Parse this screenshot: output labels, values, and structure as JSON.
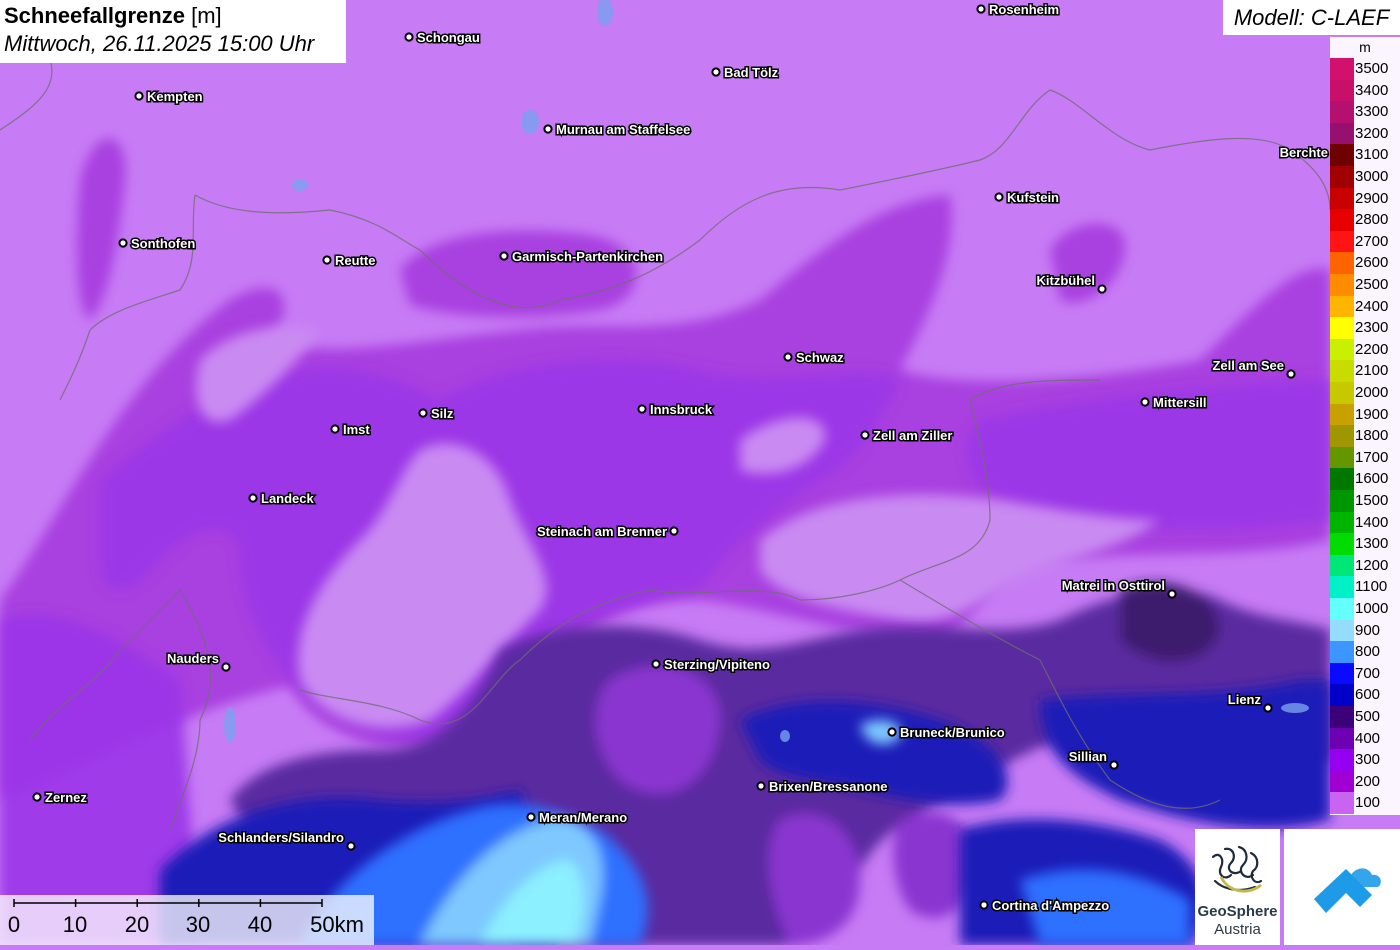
{
  "header": {
    "title": "Schneefallgrenze",
    "unit": "[m]",
    "datetime": "Mittwoch, 26.11.2025 15:00 Uhr",
    "model": "Modell: C-LAEF"
  },
  "legend": {
    "unit": "m",
    "entries": [
      {
        "label": "3500",
        "color": "#d2106e"
      },
      {
        "label": "3400",
        "color": "#c8106a"
      },
      {
        "label": "3300",
        "color": "#b41070"
      },
      {
        "label": "3200",
        "color": "#961070"
      },
      {
        "label": "3100",
        "color": "#6e0000"
      },
      {
        "label": "3000",
        "color": "#a00000"
      },
      {
        "label": "2900",
        "color": "#c80000"
      },
      {
        "label": "2800",
        "color": "#e60000"
      },
      {
        "label": "2700",
        "color": "#ff1414"
      },
      {
        "label": "2600",
        "color": "#ff6400"
      },
      {
        "label": "2500",
        "color": "#ff8c00"
      },
      {
        "label": "2400",
        "color": "#ffb400"
      },
      {
        "label": "2300",
        "color": "#ffff00"
      },
      {
        "label": "2200",
        "color": "#c8f000"
      },
      {
        "label": "2100",
        "color": "#c8dc00"
      },
      {
        "label": "2000",
        "color": "#c8c800"
      },
      {
        "label": "1900",
        "color": "#c8a000"
      },
      {
        "label": "1800",
        "color": "#a09600"
      },
      {
        "label": "1700",
        "color": "#649600"
      },
      {
        "label": "1600",
        "color": "#007800"
      },
      {
        "label": "1500",
        "color": "#009600"
      },
      {
        "label": "1400",
        "color": "#00b400"
      },
      {
        "label": "1300",
        "color": "#00dc00"
      },
      {
        "label": "1200",
        "color": "#00e678"
      },
      {
        "label": "1100",
        "color": "#00f0c8"
      },
      {
        "label": "1000",
        "color": "#64ffff"
      },
      {
        "label": "900",
        "color": "#96dcff"
      },
      {
        "label": "800",
        "color": "#3c96ff"
      },
      {
        "label": "700",
        "color": "#0a0aff"
      },
      {
        "label": "600",
        "color": "#0000c8"
      },
      {
        "label": "500",
        "color": "#3c0078"
      },
      {
        "label": "400",
        "color": "#6e00b4"
      },
      {
        "label": "300",
        "color": "#9600f0"
      },
      {
        "label": "200",
        "color": "#a000d2"
      },
      {
        "label": "100",
        "color": "#c864f0"
      }
    ]
  },
  "scale": {
    "labels": [
      "0",
      "10",
      "20",
      "30",
      "40",
      "50km"
    ]
  },
  "logos": {
    "geosphere_line1": "GeoSphere",
    "geosphere_line2": "Austria"
  },
  "cities": [
    {
      "name": "Rosenheim",
      "dot": [
        981,
        9
      ],
      "side": "right"
    },
    {
      "name": "Schongau",
      "dot": [
        409,
        37
      ],
      "side": "right"
    },
    {
      "name": "Bad Tölz",
      "dot": [
        716,
        72
      ],
      "side": "right"
    },
    {
      "name": "Kempten",
      "dot": [
        139,
        96
      ],
      "side": "right"
    },
    {
      "name": "Murnau am Staffelsee",
      "dot": [
        548,
        129
      ],
      "side": "right"
    },
    {
      "name": "Berchte",
      "dot": [
        1335,
        152
      ],
      "side": "left"
    },
    {
      "name": "Kufstein",
      "dot": [
        999,
        197
      ],
      "side": "right"
    },
    {
      "name": "Sonthofen",
      "dot": [
        123,
        243
      ],
      "side": "right"
    },
    {
      "name": "Reutte",
      "dot": [
        327,
        260
      ],
      "side": "right"
    },
    {
      "name": "Garmisch-Partenkirchen",
      "dot": [
        504,
        256
      ],
      "side": "right"
    },
    {
      "name": "Kitzbühel",
      "dot": [
        1102,
        289
      ],
      "side": "left"
    },
    {
      "name": "Schwaz",
      "dot": [
        788,
        357
      ],
      "side": "right"
    },
    {
      "name": "Zell am See",
      "dot": [
        1291,
        374
      ],
      "side": "left"
    },
    {
      "name": "Mittersill",
      "dot": [
        1145,
        402
      ],
      "side": "right"
    },
    {
      "name": "Innsbruck",
      "dot": [
        642,
        409
      ],
      "side": "right"
    },
    {
      "name": "Silz",
      "dot": [
        423,
        413
      ],
      "side": "right"
    },
    {
      "name": "Imst",
      "dot": [
        335,
        429
      ],
      "side": "right"
    },
    {
      "name": "Zell am Ziller",
      "dot": [
        865,
        435
      ],
      "side": "right"
    },
    {
      "name": "Landeck",
      "dot": [
        253,
        498
      ],
      "side": "right"
    },
    {
      "name": "Steinach am Brenner",
      "dot": [
        674,
        531
      ],
      "side": "left"
    },
    {
      "name": "Matrei in Osttirol",
      "dot": [
        1172,
        594
      ],
      "side": "left"
    },
    {
      "name": "Nauders",
      "dot": [
        226,
        667
      ],
      "side": "left"
    },
    {
      "name": "Sterzing/Vipiteno",
      "dot": [
        656,
        664
      ],
      "side": "right"
    },
    {
      "name": "Lienz",
      "dot": [
        1268,
        708
      ],
      "side": "left"
    },
    {
      "name": "Bruneck/Brunico",
      "dot": [
        892,
        732
      ],
      "side": "right"
    },
    {
      "name": "Sillian",
      "dot": [
        1114,
        765
      ],
      "side": "left"
    },
    {
      "name": "Brixen/Bressanone",
      "dot": [
        761,
        786
      ],
      "side": "right"
    },
    {
      "name": "Zernez",
      "dot": [
        37,
        797
      ],
      "side": "right"
    },
    {
      "name": "Meran/Merano",
      "dot": [
        531,
        817
      ],
      "side": "right"
    },
    {
      "name": "Schlanders/Silandro",
      "dot": [
        351,
        846
      ],
      "side": "left"
    },
    {
      "name": "Cortina d'Ampezzo",
      "dot": [
        984,
        905
      ],
      "side": "right"
    }
  ]
}
